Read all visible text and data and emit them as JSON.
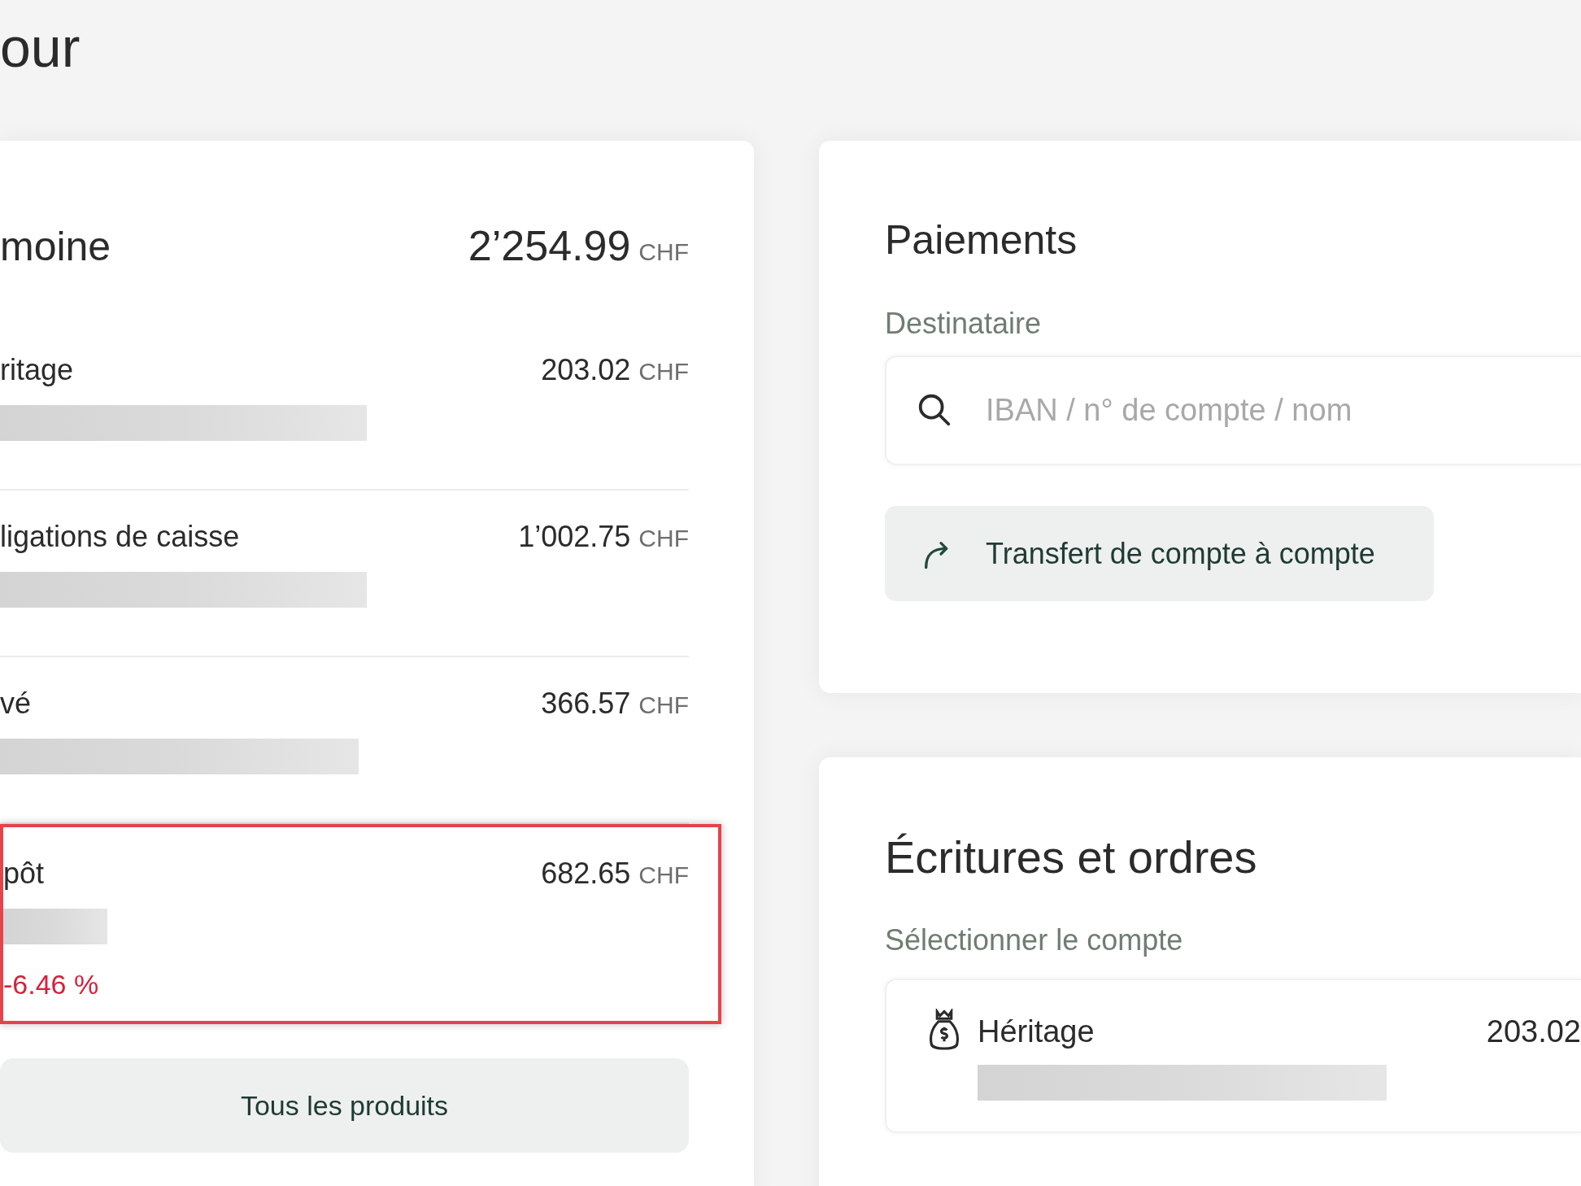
{
  "page_title": "our",
  "assets": {
    "title": "moine",
    "total": "2’254.99",
    "currency": "CHF",
    "products": [
      {
        "name": "ritage",
        "amount": "203.02",
        "currency": "CHF",
        "highlighted": false
      },
      {
        "name": "ligations de caisse",
        "amount": "1’002.75",
        "currency": "CHF",
        "highlighted": false
      },
      {
        "name": "vé",
        "amount": "366.57",
        "currency": "CHF",
        "highlighted": false
      },
      {
        "name": "pôt",
        "amount": "682.65",
        "currency": "CHF",
        "change": "-6.46 %",
        "highlighted": true
      }
    ],
    "all_button": "Tous les produits"
  },
  "payments": {
    "title": "Paiements",
    "recipient_label": "Destinataire",
    "search": {
      "placeholder": "IBAN / n° de compte / nom"
    },
    "transfer_button": "Transfert de compte à compte"
  },
  "entries": {
    "title": "Écritures et ordres",
    "account_label": "Sélectionner le compte",
    "account": {
      "name": "Héritage",
      "amount": "203.02"
    }
  }
}
